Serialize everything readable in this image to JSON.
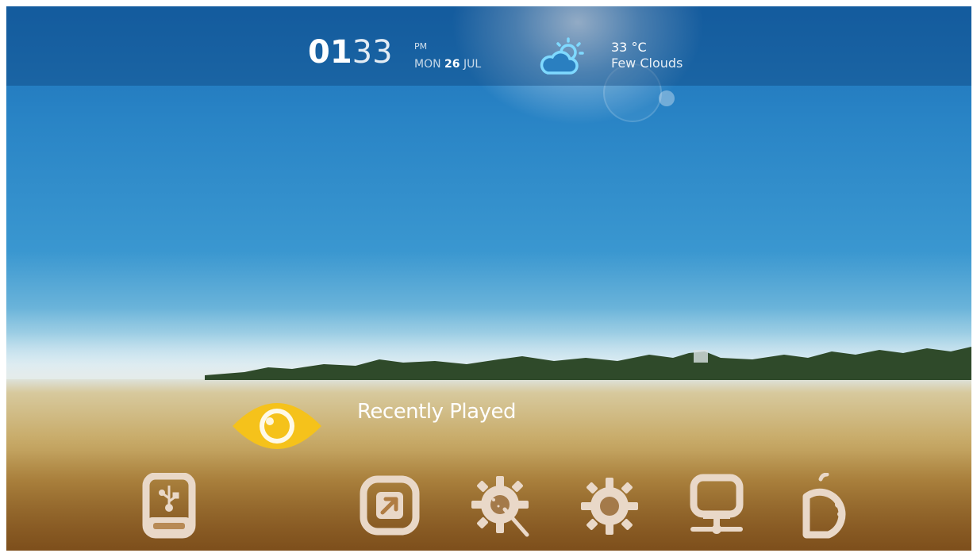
{
  "clock": {
    "hour": "01",
    "minute": "33",
    "ampm": "PM",
    "weekday": "MON",
    "day": "26",
    "month": "JUL"
  },
  "weather": {
    "temperature": "33 °C",
    "condition": "Few Clouds",
    "icon": "partly-cloudy-icon"
  },
  "focus": {
    "label": "Recently Played",
    "icon": "eye-icon",
    "accent": "#f5c21b"
  },
  "dock": [
    {
      "name": "usb-drive-icon"
    },
    {
      "name": "shortcut-arrow-icon"
    },
    {
      "name": "wizard-gear-icon"
    },
    {
      "name": "settings-gear-icon"
    },
    {
      "name": "network-computer-icon"
    },
    {
      "name": "apps-icon"
    }
  ]
}
